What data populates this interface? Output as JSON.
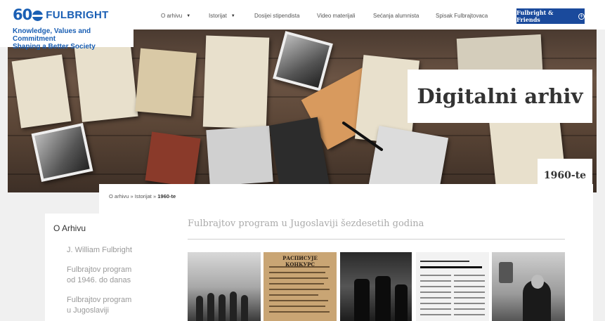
{
  "header": {
    "logo_number": "60",
    "logo_text": "FULBRIGHT",
    "tagline_line1": "Knowledge, Values and Commitment",
    "tagline_line2": "Shaping a Better Society",
    "nav": [
      {
        "label": "O arhivu",
        "has_dropdown": true
      },
      {
        "label": "Istorijat",
        "has_dropdown": true
      },
      {
        "label": "Dosijei stipendista",
        "has_dropdown": false
      },
      {
        "label": "Video materijali",
        "has_dropdown": false
      },
      {
        "label": "Sećanja alumnista",
        "has_dropdown": false
      },
      {
        "label": "Spisak Fulbrajtovaca",
        "has_dropdown": false
      }
    ],
    "cta_label": "Fulbright & Friends",
    "cta_icon": "plus-circle-icon"
  },
  "hero": {
    "title": "Digitalni arhiv",
    "decade": "1960-te"
  },
  "breadcrumb": {
    "item1": "O arhivu",
    "sep": "»",
    "item2": "Istorijat",
    "current": "1960-te"
  },
  "sidebar": {
    "title": "O Arhivu",
    "items": [
      {
        "label": "J. William Fulbright"
      },
      {
        "label_line1": "Fulbrajtov program",
        "label_line2": "od 1946. do danas"
      },
      {
        "label_line1": "Fulbrajtov program",
        "label_line2": "u Jugoslaviji"
      }
    ]
  },
  "main": {
    "section_title": "Fulbrajtov program u Jugoslaviji šezdesetih godina",
    "thumbnails": [
      {
        "name": "group-photo"
      },
      {
        "name": "newspaper-clipping",
        "heading": "РАСПИСУЈЕ КОНКУРС"
      },
      {
        "name": "reception-photo"
      },
      {
        "name": "article-page"
      },
      {
        "name": "portrait-photo"
      }
    ]
  },
  "colors": {
    "brand_blue": "#1a5fb4",
    "cta_blue": "#1a4a9c"
  }
}
